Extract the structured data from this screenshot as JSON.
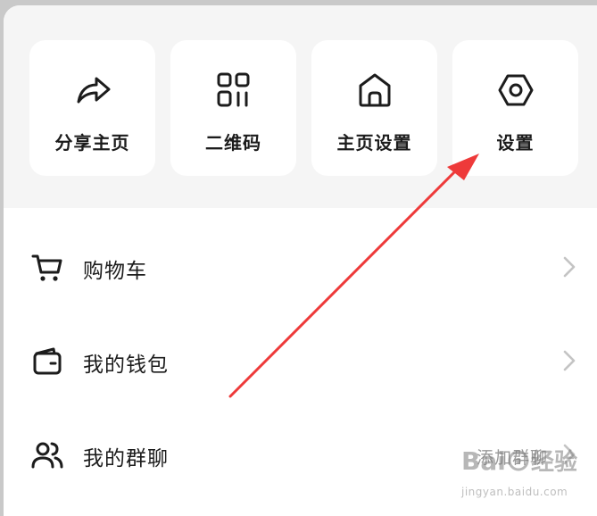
{
  "quick_actions": [
    {
      "label": "分享主页",
      "icon": "share-icon"
    },
    {
      "label": "二维码",
      "icon": "qr-code-icon"
    },
    {
      "label": "主页设置",
      "icon": "home-icon"
    },
    {
      "label": "设置",
      "icon": "hexagon-settings-icon"
    }
  ],
  "menu": [
    {
      "label": "购物车",
      "icon": "shopping-cart-icon",
      "extra": ""
    },
    {
      "label": "我的钱包",
      "icon": "wallet-icon",
      "extra": ""
    },
    {
      "label": "我的群聊",
      "icon": "users-icon",
      "extra": "添加群聊"
    }
  ],
  "annotation": {
    "color": "#ee3a3a",
    "points_to": "设置"
  },
  "watermark": {
    "brand": "Baidu 经验",
    "url": "jingyan.baidu.com"
  },
  "colors": {
    "panel_bg": "#f5f5f5",
    "card_bg": "#ffffff",
    "text": "#1c1c1c",
    "muted": "#9a9a9a",
    "chevron": "#c4c4c4"
  }
}
